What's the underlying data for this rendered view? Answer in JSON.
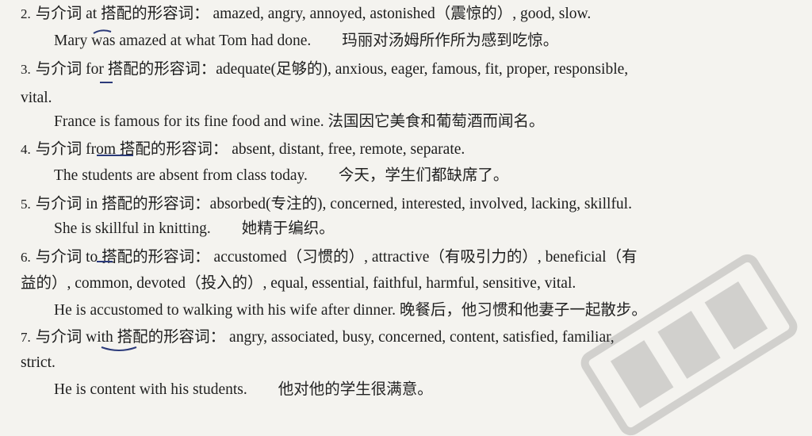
{
  "rules": [
    {
      "num": "2.",
      "header": "与介词 at 搭配的形容词： amazed, angry, annoyed, astonished（震惊的）, good, slow.",
      "example": "Mary was amazed at what Tom had done.　　玛丽对汤姆所作所为感到吃惊。"
    },
    {
      "num": "3.",
      "header": "与介词 for 搭配的形容词：adequate(足够的), anxious, eager, famous, fit, proper, responsible,",
      "cont": "vital.",
      "example": "France is famous for its fine food and wine. 法国因它美食和葡萄酒而闻名。"
    },
    {
      "num": "4.",
      "header": "与介词 from 搭配的形容词： absent, distant, free, remote, separate.",
      "example": "The students are absent from class today.　　今天，学生们都缺席了。"
    },
    {
      "num": "5.",
      "header": "与介词 in 搭配的形容词：absorbed(专注的), concerned, interested, involved, lacking, skillful.",
      "example": "She is skillful in knitting.　　她精于编织。"
    },
    {
      "num": "6.",
      "header": "与介词 to 搭配的形容词： accustomed（习惯的）, attractive（有吸引力的）, beneficial（有",
      "cont": "益的）, common, devoted（投入的）, equal, essential, faithful, harmful, sensitive, vital.",
      "example": "He is accustomed to walking with his wife after dinner. 晚餐后，他习惯和他妻子一起散步。"
    },
    {
      "num": "7.",
      "header": "与介词 with 搭配的形容词： angry, associated, busy, concerned, content, satisfied, familiar,",
      "cont": "strict.",
      "example": "He is content with his students.　　他对他的学生很满意。"
    }
  ]
}
